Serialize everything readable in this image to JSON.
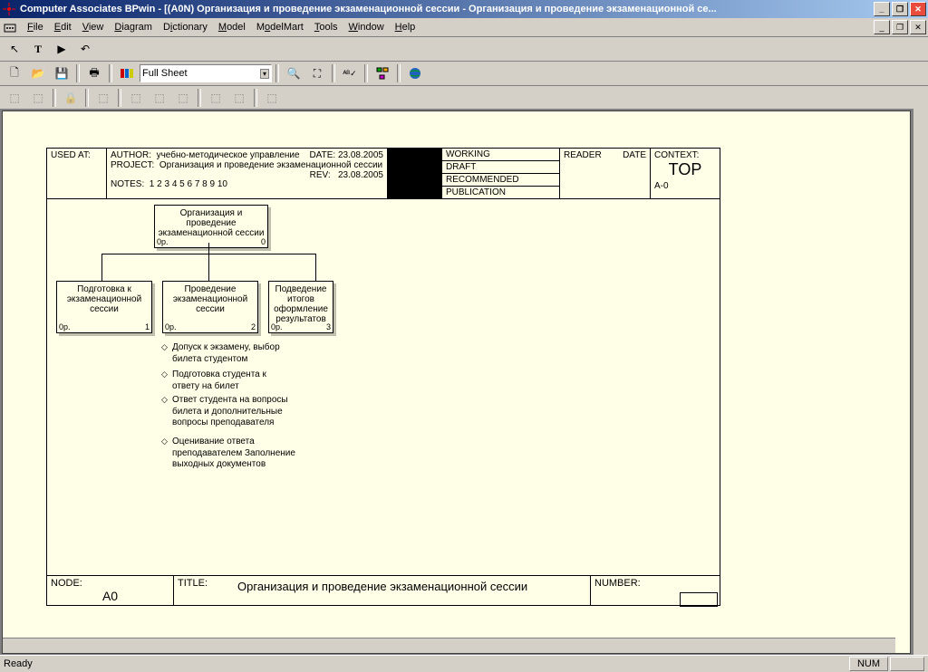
{
  "window": {
    "title": "Computer Associates BPwin - [(A0N) Организация и проведение  экзаменационной сессии   - Организация и проведение экзаменационной се..."
  },
  "menu": {
    "file": "File",
    "edit": "Edit",
    "view": "View",
    "diagram": "Diagram",
    "dictionary": "Dictionary",
    "model": "Model",
    "modelmart": "ModelMart",
    "tools": "Tools",
    "window": "Window",
    "help": "Help"
  },
  "toolbar": {
    "zoom_combo": "Full Sheet"
  },
  "header": {
    "used_at": "USED AT:",
    "author_label": "AUTHOR:",
    "author": "учебно-методическое управление",
    "project_label": "PROJECT:",
    "project": "Организация и проведение экзаменационной сессии",
    "notes_label": "NOTES:",
    "notes": "1  2  3  4  5  6  7  8  9  10",
    "date_label": "DATE:",
    "date": "23.08.2005",
    "rev_label": "REV:",
    "rev": "23.08.2005",
    "working": "WORKING",
    "draft": "DRAFT",
    "recommended": "RECOMMENDED",
    "publication": "PUBLICATION",
    "reader": "READER",
    "hdate": "DATE",
    "context_label": "CONTEXT:",
    "context": "TOP",
    "context_code": "A-0"
  },
  "nodes": {
    "root": {
      "title": "Организация и проведение экзаменационной сессии",
      "pfx": "0р.",
      "num": "0"
    },
    "n1": {
      "title": "Подготовка к экзаменационной сессии",
      "pfx": "0р.",
      "num": "1"
    },
    "n2": {
      "title": "Проведение экзаменационной сессии",
      "pfx": "0р.",
      "num": "2"
    },
    "n3": {
      "title": "Подведение итогов оформление результатов",
      "pfx": "0р.",
      "num": "3"
    }
  },
  "subitems": [
    "Допуск к экзамену, выбор билета студентом",
    "Подготовка студента к ответу  на билет",
    "Ответ студента на вопросы билета и дополнительные вопросы преподавателя",
    "Оценивание ответа преподавателем Заполнение выходных документов"
  ],
  "footer": {
    "node_label": "NODE:",
    "node": "A0",
    "title_label": "TITLE:",
    "title": "Организация и проведение  экзаменационной сессии",
    "number_label": "NUMBER:"
  },
  "status": {
    "ready": "Ready",
    "num": "NUM"
  }
}
